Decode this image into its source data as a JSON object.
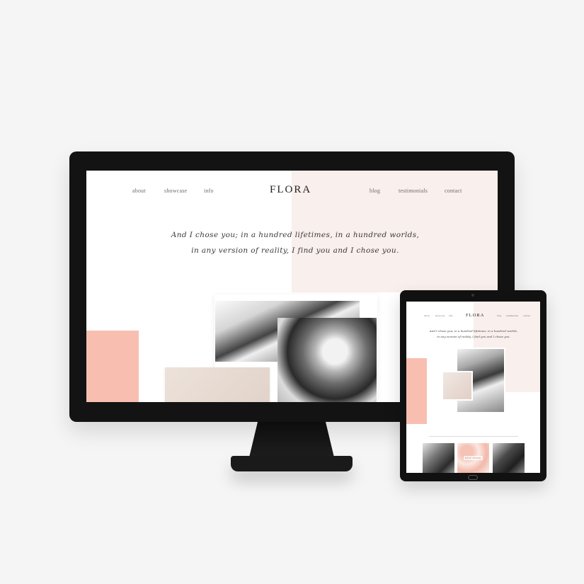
{
  "desktop": {
    "logo": "FLORA",
    "nav_left": [
      "about",
      "showcase",
      "info"
    ],
    "nav_right": [
      "blog",
      "testimonials",
      "contact"
    ],
    "script_line_1": "And I chose you; in a hundred lifetimes, in a hundred worlds,",
    "script_line_2": "in any version of reality, I find you and I chose you."
  },
  "tablet": {
    "logo": "FLORA",
    "nav_left": [
      "about",
      "showcase",
      "info"
    ],
    "nav_right": [
      "blog",
      "testimonials",
      "contact"
    ],
    "script_line_1": "And I chose you; in a hundred lifetimes, in a hundred worlds,",
    "script_line_2": "in any version of reality, I find you and I chose you.",
    "thumb_caption": "NEW WORK"
  },
  "colors": {
    "accent_coral": "#f8bfb0",
    "blush": "#f9efec",
    "device_black": "#131313",
    "background": "#f5f5f5"
  }
}
